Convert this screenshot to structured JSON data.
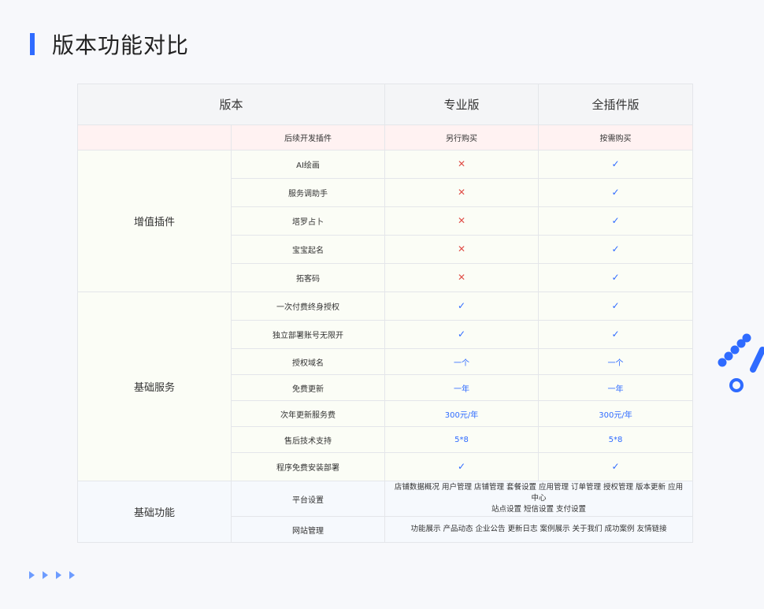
{
  "page": {
    "title": "版本功能对比",
    "accent": "#2f6bff"
  },
  "table": {
    "header": {
      "version": "版本",
      "pro": "专业版",
      "all": "全插件版"
    },
    "purchase_row": {
      "label": "后续开发插件",
      "pro": "另行购买",
      "all": "按需购买"
    },
    "groups": [
      {
        "name": "增值插件",
        "rows": [
          {
            "label": "AI绘画",
            "pro": "✕",
            "all": "✓"
          },
          {
            "label": "服务调助手",
            "pro": "✕",
            "all": "✓"
          },
          {
            "label": "塔罗占卜",
            "pro": "✕",
            "all": "✓"
          },
          {
            "label": "宝宝起名",
            "pro": "✕",
            "all": "✓"
          },
          {
            "label": "拓客码",
            "pro": "✕",
            "all": "✓"
          }
        ]
      },
      {
        "name": "基础服务",
        "rows": [
          {
            "label": "一次付费终身授权",
            "pro": "✓",
            "all": "✓"
          },
          {
            "label": "独立部署账号无限开",
            "pro": "✓",
            "all": "✓"
          },
          {
            "label": "授权域名",
            "pro": "一个",
            "all": "一个"
          },
          {
            "label": "免费更新",
            "pro": "一年",
            "all": "一年"
          },
          {
            "label": "次年更新服务费",
            "pro": "300元/年",
            "all": "300元/年"
          },
          {
            "label": "售后技术支持",
            "pro": "5*8",
            "all": "5*8"
          },
          {
            "label": "程序免费安装部署",
            "pro": "✓",
            "all": "✓"
          }
        ]
      },
      {
        "name": "基础功能",
        "rows": [
          {
            "label": "平台设置",
            "value_line1": "店铺数据概况 用户管理 店铺管理 套餐设置 应用管理 订单管理 授权管理 版本更新 应用中心",
            "value_line2": "站点设置 短信设置 支付设置"
          },
          {
            "label": "网站管理",
            "value_line1": "功能展示 产品动态 企业公告 更新日志 案例展示 关于我们 成功案例 友情链接"
          }
        ]
      }
    ]
  }
}
